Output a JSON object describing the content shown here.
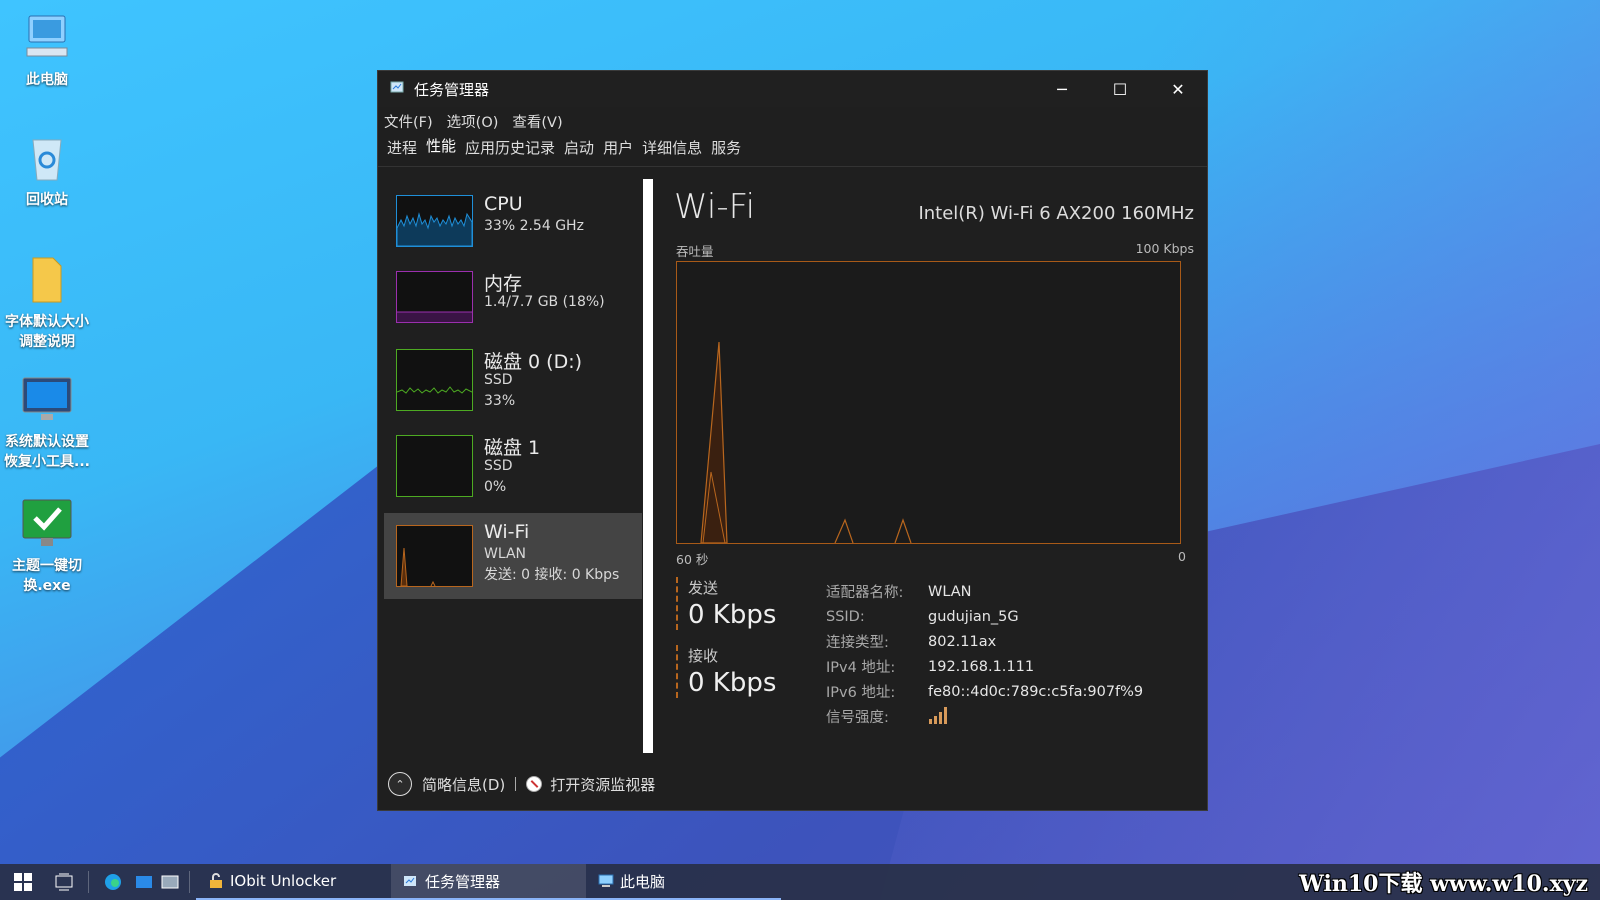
{
  "desktop": {
    "icons": [
      {
        "label": "此电脑"
      },
      {
        "label": "回收站"
      },
      {
        "label": "字体默认大小调整说明"
      },
      {
        "label": "系统默认设置恢复小工具..."
      },
      {
        "label": "主题一键切换.exe"
      }
    ]
  },
  "window": {
    "title": "任务管理器",
    "minimize": "─",
    "maximize": "☐",
    "close": "✕",
    "menu": [
      "文件(F)",
      "选项(O)",
      "查看(V)"
    ],
    "tabs": [
      "进程",
      "性能",
      "应用历史记录",
      "启动",
      "用户",
      "详细信息",
      "服务"
    ],
    "active_tab": "性能"
  },
  "perf_list": [
    {
      "name": "CPU",
      "sub1": "33%  2.54 GHz",
      "color": "#1f8fd8"
    },
    {
      "name": "内存",
      "sub1": "1.4/7.7 GB (18%)",
      "color": "#9b2fae"
    },
    {
      "name": "磁盘 0 (D:)",
      "sub1": "SSD",
      "sub2": "33%",
      "color": "#4daa22"
    },
    {
      "name": "磁盘 1",
      "sub1": "SSD",
      "sub2": "0%",
      "color": "#4daa22"
    },
    {
      "name": "Wi-Fi",
      "sub1": "WLAN",
      "sub2": "发送: 0 接收: 0 Kbps",
      "color": "#b8661e"
    }
  ],
  "detail": {
    "title": "Wi-Fi",
    "adapter_model": "Intel(R) Wi-Fi 6 AX200 160MHz",
    "graph_label": "吞吐量",
    "graph_max": "100 Kbps",
    "graph_span": "60 秒",
    "graph_min": "0",
    "send_label": "发送",
    "send_value": "0 Kbps",
    "recv_label": "接收",
    "recv_value": "0 Kbps",
    "properties": [
      {
        "key": "适配器名称:",
        "value": "WLAN"
      },
      {
        "key": "SSID:",
        "value": "gudujian_5G"
      },
      {
        "key": "连接类型:",
        "value": "802.11ax"
      },
      {
        "key": "IPv4 地址:",
        "value": "192.168.1.111"
      },
      {
        "key": "IPv6 地址:",
        "value": "fe80::4d0c:789c:c5fa:907f%9"
      },
      {
        "key": "信号强度:",
        "value": ""
      }
    ],
    "accent": "#b8661e"
  },
  "footer": {
    "fewer_details": "简略信息(D)",
    "open_resmon": "打开资源监视器"
  },
  "taskbar": {
    "apps": [
      {
        "label": "IObit Unlocker"
      },
      {
        "label": "任务管理器"
      },
      {
        "label": "此电脑"
      }
    ]
  },
  "watermark": "Win10下载 www.w10.xyz"
}
